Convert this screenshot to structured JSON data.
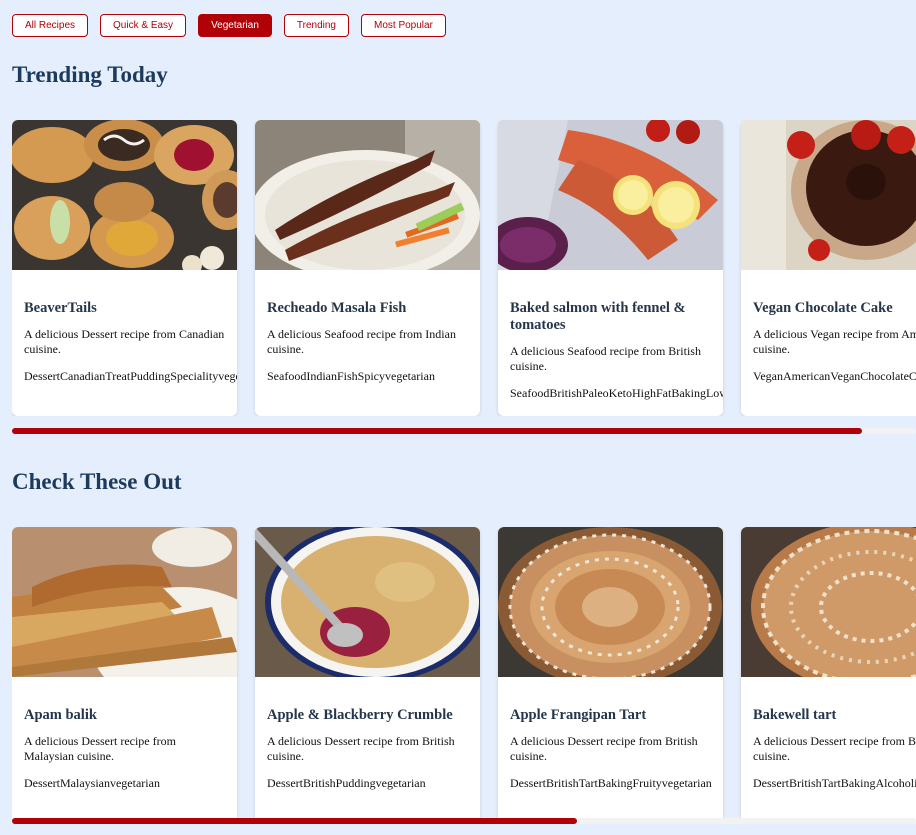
{
  "filters": [
    {
      "label": "All Recipes",
      "active": false
    },
    {
      "label": "Quick & Easy",
      "active": false
    },
    {
      "label": "Vegetarian",
      "active": true
    },
    {
      "label": "Trending",
      "active": false
    },
    {
      "label": "Most Popular",
      "active": false
    }
  ],
  "sections": [
    {
      "title": "Trending Today",
      "scroll_fraction": 0.94,
      "cards": [
        {
          "title": "BeaverTails",
          "description": "A delicious Dessert recipe from Canadian cuisine.",
          "tags": "DessertCanadianTreatPuddingSpecialityvegetarian",
          "image": "pastries"
        },
        {
          "title": "Recheado Masala Fish",
          "description": "A delicious Seafood recipe from Indian cuisine.",
          "tags": "SeafoodIndianFishSpicyvegetarian",
          "image": "fish"
        },
        {
          "title": "Baked salmon with fennel & tomatoes",
          "description": "A delicious Seafood recipe from British cuisine.",
          "tags": "SeafoodBritishPaleoKetoHighFatBakingLowCarbsvegetarian",
          "image": "salmon"
        },
        {
          "title": "Vegan Chocolate Cake",
          "description": "A delicious Vegan recipe from American cuisine.",
          "tags": "VeganAmericanVeganChocolateCakevegetarian",
          "image": "chocolate-cake"
        }
      ]
    },
    {
      "title": "Check These Out",
      "scroll_fraction": 0.625,
      "cards": [
        {
          "title": "Apam balik",
          "description": "A delicious Dessert recipe from Malaysian cuisine.",
          "tags": "DessertMalaysianvegetarian",
          "image": "pancake"
        },
        {
          "title": "Apple & Blackberry Crumble",
          "description": "A delicious Dessert recipe from British cuisine.",
          "tags": "DessertBritishPuddingvegetarian",
          "image": "crumble"
        },
        {
          "title": "Apple Frangipan Tart",
          "description": "A delicious Dessert recipe from British cuisine.",
          "tags": "DessertBritishTartBakingFruityvegetarian",
          "image": "apple-tart"
        },
        {
          "title": "Bakewell tart",
          "description": "A delicious Dessert recipe from British cuisine.",
          "tags": "DessertBritishTartBakingAlcoholicvegetarian",
          "image": "bakewell"
        }
      ]
    }
  ],
  "colors": {
    "accent": "#b00008",
    "background": "#e5eefc",
    "heading": "#1c3a5b"
  }
}
